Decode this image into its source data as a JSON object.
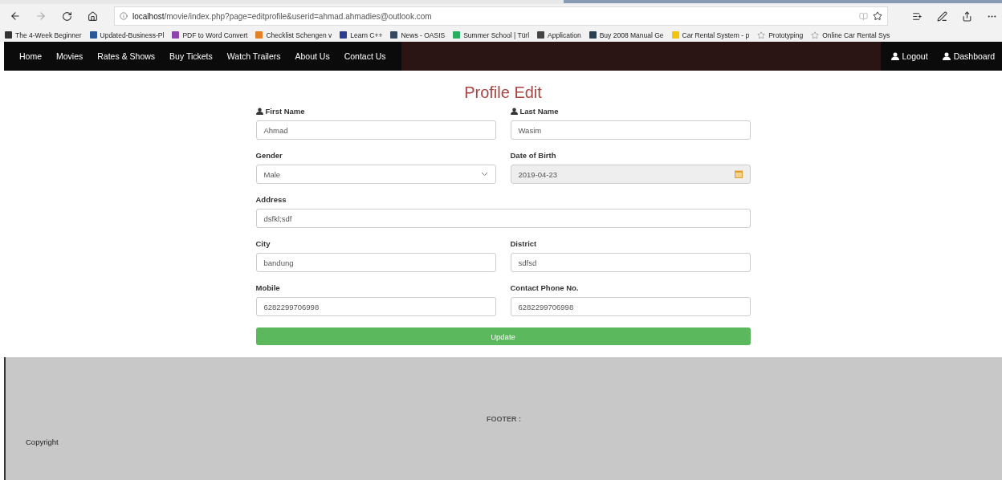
{
  "browser": {
    "url_host": "localhost",
    "url_path": "/movie/index.php?page=editprofile&userid=ahmad.ahmadies@outlook.com"
  },
  "bookmarks": [
    {
      "label": "The 4-Week Beginner",
      "kind": "favicon",
      "color": "#333333"
    },
    {
      "label": "Updated-Business-Pl",
      "kind": "favicon",
      "color": "#2b5797"
    },
    {
      "label": "PDF to Word Convert",
      "kind": "favicon",
      "color": "#8e44ad"
    },
    {
      "label": "Checklist Schengen v",
      "kind": "favicon",
      "color": "#e67e22"
    },
    {
      "label": "Learn C++",
      "kind": "favicon",
      "color": "#2c3e90"
    },
    {
      "label": "News - OASIS",
      "kind": "favicon",
      "color": "#34495e"
    },
    {
      "label": "Summer School | Türl",
      "kind": "favicon",
      "color": "#27ae60"
    },
    {
      "label": "Application",
      "kind": "favicon",
      "color": "#444444"
    },
    {
      "label": "Buy 2008 Manual Ge",
      "kind": "favicon",
      "color": "#2c3e50"
    },
    {
      "label": "Car Rental System - p",
      "kind": "favicon",
      "color": "#f1c40f"
    },
    {
      "label": "Prototyping",
      "kind": "star"
    },
    {
      "label": "Online Car Rental Sys",
      "kind": "star"
    }
  ],
  "nav": {
    "items": [
      "Home",
      "Movies",
      "Rates & Shows",
      "Buy Tickets",
      "Watch Trailers",
      "About Us",
      "Contact Us"
    ],
    "right": [
      "Logout",
      "Dashboard"
    ]
  },
  "form": {
    "title": "Profile Edit",
    "rows": [
      [
        {
          "label": "First Name",
          "icon": true,
          "kind": "text",
          "value": "Ahmad",
          "disabled": false
        },
        {
          "label": "Last Name",
          "icon": true,
          "kind": "text",
          "value": "Wasim",
          "disabled": false
        }
      ],
      [
        {
          "label": "Gender",
          "icon": false,
          "kind": "select",
          "value": "Male",
          "disabled": false
        },
        {
          "label": "Date of Birth",
          "icon": false,
          "kind": "date",
          "value": "2019-04-23",
          "disabled": true
        }
      ],
      [
        {
          "label": "Address",
          "icon": false,
          "kind": "text",
          "value": "dsfkl;sdf",
          "disabled": false
        }
      ],
      [
        {
          "label": "City",
          "icon": false,
          "kind": "text",
          "value": "bandung",
          "disabled": false
        },
        {
          "label": "District",
          "icon": false,
          "kind": "text",
          "value": "sdfsd",
          "disabled": false
        }
      ],
      [
        {
          "label": "Mobile",
          "icon": false,
          "kind": "text",
          "value": "6282299706998",
          "disabled": false
        },
        {
          "label": "Contact Phone No.",
          "icon": false,
          "kind": "text",
          "value": "6282299706998",
          "disabled": false
        }
      ]
    ],
    "button": "Update"
  },
  "footer": {
    "title": "FOOTER :",
    "copyright": "Copyright"
  }
}
